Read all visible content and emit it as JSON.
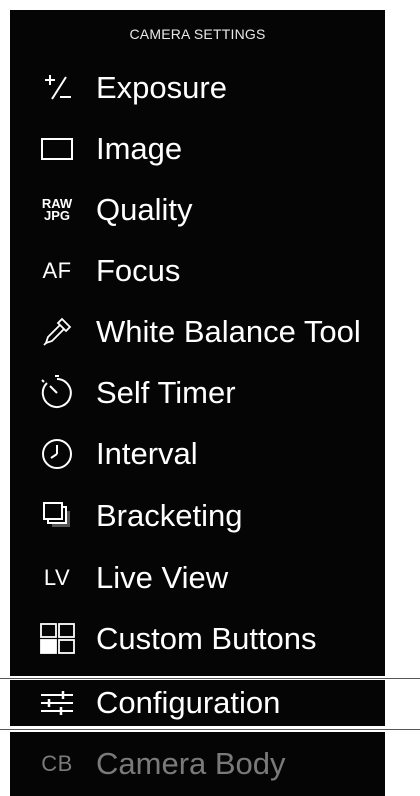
{
  "header": {
    "title": "CAMERA SETTINGS"
  },
  "menu": [
    {
      "icon": "exposure-icon",
      "label": "Exposure"
    },
    {
      "icon": "image-icon",
      "label": "Image"
    },
    {
      "icon": "quality-icon",
      "icon_text_top": "RAW",
      "icon_text_bottom": "JPG",
      "label": "Quality"
    },
    {
      "icon": "af-icon",
      "icon_text": "AF",
      "label": "Focus"
    },
    {
      "icon": "eyedropper-icon",
      "label": "White Balance Tool"
    },
    {
      "icon": "self-timer-icon",
      "label": "Self Timer"
    },
    {
      "icon": "interval-clock-icon",
      "label": "Interval"
    },
    {
      "icon": "bracketing-icon",
      "label": "Bracketing"
    },
    {
      "icon": "lv-icon",
      "icon_text": "LV",
      "label": "Live View"
    },
    {
      "icon": "custom-buttons-icon",
      "label": "Custom Buttons"
    }
  ],
  "configuration": {
    "icon": "sliders-icon",
    "label": "Configuration"
  },
  "camera_body": {
    "icon": "cb-icon",
    "icon_text": "CB",
    "label": "Camera Body"
  },
  "colors": {
    "panel": "#050505",
    "text": "#ffffff",
    "disabled_text": "#7a7a7a",
    "background": "#ffffff"
  }
}
